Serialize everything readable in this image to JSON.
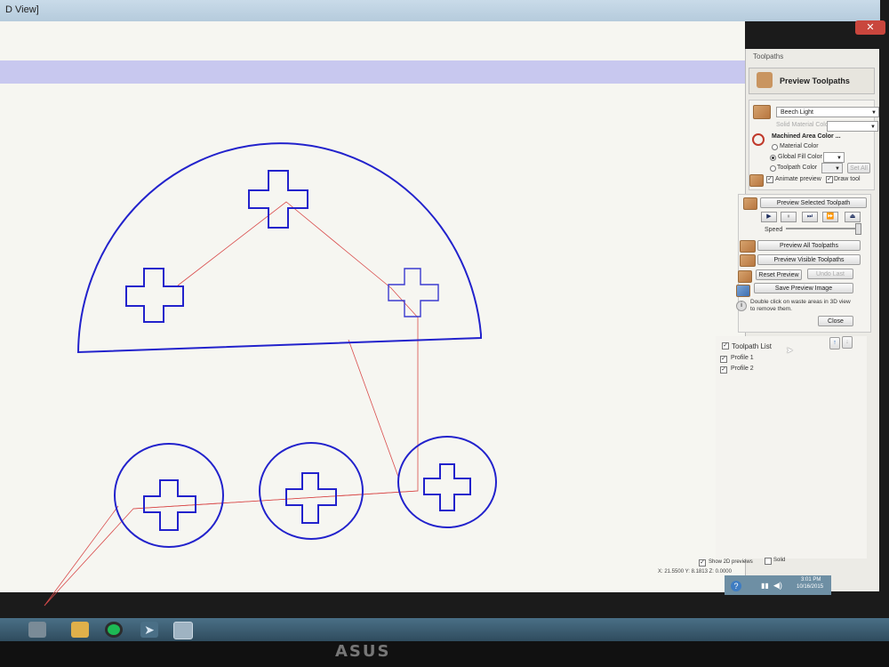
{
  "window": {
    "title": "D View]",
    "close_label": "✕"
  },
  "panel": {
    "title": "Toolpaths",
    "header": "Preview Toolpaths",
    "material": {
      "value": "Beech Light",
      "solid_color_label": "Solid Material Color"
    },
    "machined": {
      "title": "Machined Area Color ...",
      "material_color": "Material Color",
      "global_fill_color": "Global Fill Color",
      "toolpath_color": "Toolpath Color",
      "set_all": "Set All"
    },
    "animate_preview": "Animate preview",
    "draw_tool": "Draw tool",
    "preview_selected": "Preview Selected Toolpath",
    "controls": [
      "▶",
      "⏸",
      "⏭",
      "⏩",
      "⏏"
    ],
    "speed_label": "Speed",
    "speed_value": 0.95,
    "preview_all": "Preview All Toolpaths",
    "preview_visible": "Preview Visible Toolpaths",
    "reset_preview": "Reset Preview",
    "undo_last": "Undo Last",
    "save_image": "Save Preview Image",
    "hint_line1": "Double click on waste areas in 3D view",
    "hint_line2": "to remove them.",
    "close": "Close"
  },
  "toolpath_list": {
    "title": "Toolpath List",
    "items": [
      "Profile 1",
      "Profile 2"
    ]
  },
  "bottom": {
    "show_2d": "Show 2D previews",
    "solid": "Solid",
    "coords": "X: 21.5500 Y: 8.1813 Z: 0.0000"
  },
  "tray": {
    "time": "3:01 PM",
    "date": "10/16/2015"
  },
  "brand": "ASUS"
}
